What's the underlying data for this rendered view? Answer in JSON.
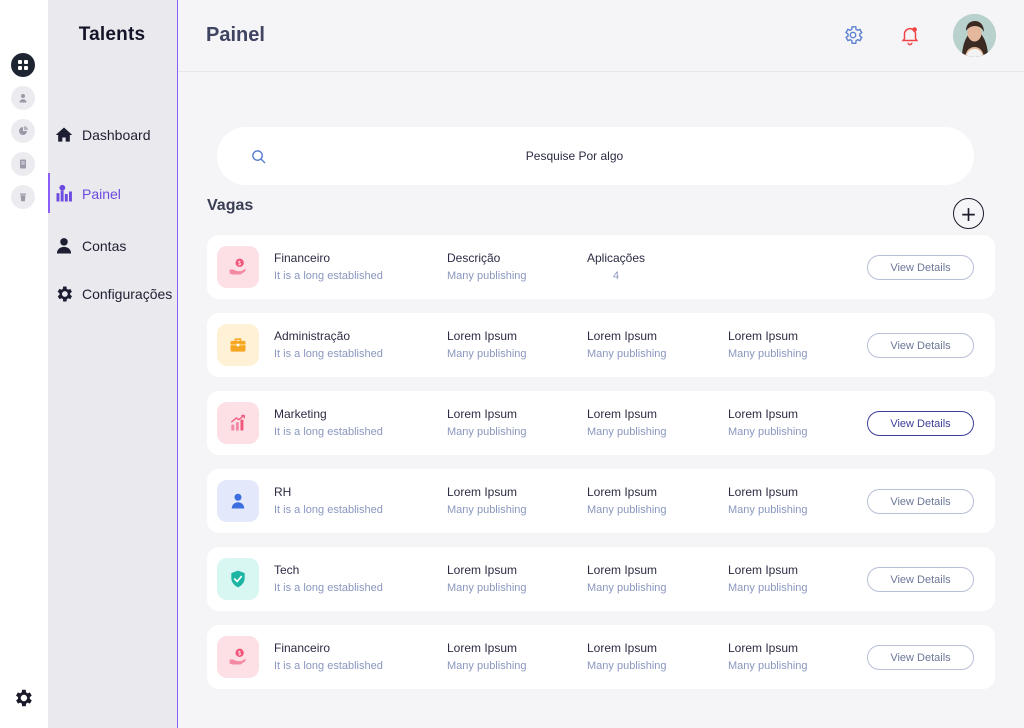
{
  "brand": "Talents",
  "header": {
    "title": "Painel"
  },
  "sidebar": {
    "items": [
      {
        "label": "Dashboard",
        "icon": "home-icon"
      },
      {
        "label": "Painel",
        "icon": "chart-icon",
        "active": true
      },
      {
        "label": "Contas",
        "icon": "user-icon"
      },
      {
        "label": "Configurações",
        "icon": "gear-icon"
      }
    ]
  },
  "search": {
    "placeholder": "Pesquise Por algo"
  },
  "section": {
    "title": "Vagas",
    "add_label": "+"
  },
  "colors": {
    "accent": "#8b5cf6",
    "notification": "#ef4444",
    "link": "#8a97bf"
  },
  "jobs": [
    {
      "title": "Financeiro",
      "subtitle": "It is a long established",
      "icon": "money-hand-icon",
      "cols": [
        {
          "title": "Descrição",
          "sub": "Many publishing"
        },
        {
          "title": "Aplicações",
          "sub": "4"
        }
      ],
      "button": "View Details"
    },
    {
      "title": "Administração",
      "subtitle": "It is a long established",
      "icon": "briefcase-icon",
      "cols": [
        {
          "title": "Lorem Ipsum",
          "sub": "Many publishing"
        },
        {
          "title": "Lorem Ipsum",
          "sub": "Many publishing"
        },
        {
          "title": "Lorem Ipsum",
          "sub": "Many publishing"
        }
      ],
      "button": "View Details"
    },
    {
      "title": "Marketing",
      "subtitle": "It is a long established",
      "icon": "growth-chart-icon",
      "cols": [
        {
          "title": "Lorem Ipsum",
          "sub": "Many publishing"
        },
        {
          "title": "Lorem Ipsum",
          "sub": "Many publishing"
        },
        {
          "title": "Lorem Ipsum",
          "sub": "Many publishing"
        }
      ],
      "button": "View Details"
    },
    {
      "title": "RH",
      "subtitle": "It is a long established",
      "icon": "person-icon",
      "cols": [
        {
          "title": "Lorem Ipsum",
          "sub": "Many publishing"
        },
        {
          "title": "Lorem Ipsum",
          "sub": "Many publishing"
        },
        {
          "title": "Lorem Ipsum",
          "sub": "Many publishing"
        }
      ],
      "button": "View Details"
    },
    {
      "title": "Tech",
      "subtitle": "It is a long established",
      "icon": "shield-check-icon",
      "cols": [
        {
          "title": "Lorem Ipsum",
          "sub": "Many publishing"
        },
        {
          "title": "Lorem Ipsum",
          "sub": "Many publishing"
        },
        {
          "title": "Lorem Ipsum",
          "sub": "Many publishing"
        }
      ],
      "button": "View Details"
    },
    {
      "title": "Financeiro",
      "subtitle": "It is a long established",
      "icon": "money-hand-icon",
      "cols": [
        {
          "title": "Lorem Ipsum",
          "sub": "Many publishing"
        },
        {
          "title": "Lorem Ipsum",
          "sub": "Many publishing"
        },
        {
          "title": "Lorem Ipsum",
          "sub": "Many publishing"
        }
      ],
      "button": "View Details"
    }
  ]
}
